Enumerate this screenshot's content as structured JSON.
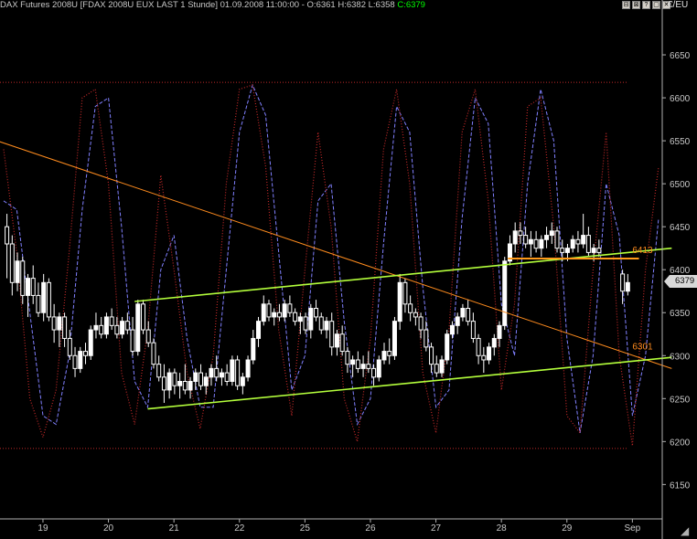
{
  "header": {
    "title": "DAX Futures 2008U [FDAX 2008U EUX LAST 1 Stunde]",
    "datetime": "01.09.2008 11:00:00",
    "ohlc": "- O:6361 H:6382 L:6358",
    "close": "C:6379",
    "currency": "€/EU",
    "window_buttons": [
      "⊟",
      "⊠",
      "?",
      "▢",
      "✕"
    ]
  },
  "last_price_label": "6379",
  "colors": {
    "background": "#000000",
    "candle": "#ffffff",
    "stoch_k": "#c02828",
    "stoch_d": "#8080ff",
    "channel_lines": "#b4ff3c",
    "downtrend_line": "#ff8c1e",
    "horizontal_resistance": "#ff9a1a",
    "labels_orange": "#ff8c1e",
    "grid_text": "#c8c8c8",
    "close_value": "#00ff00"
  },
  "chart_data": {
    "type": "candlestick",
    "title": "DAX Futures 2008U [FDAX 2008U EUX LAST 1 Stunde]",
    "ylabel": "€/EU",
    "ylim": [
      6110,
      6700
    ],
    "yticks": [
      6150,
      6200,
      6250,
      6300,
      6350,
      6400,
      6450,
      6500,
      6550,
      6600,
      6650
    ],
    "xticks": [
      "19",
      "20",
      "21",
      "22",
      "25",
      "26",
      "27",
      "28",
      "29",
      "Sep"
    ],
    "x_index_range": [
      0,
      100
    ],
    "xtick_index": [
      6,
      16,
      26,
      36,
      46,
      56,
      66,
      76,
      86,
      96
    ],
    "candles": [
      [
        0.5,
        6450,
        6465,
        6390,
        6430
      ],
      [
        1.3,
        6430,
        6440,
        6370,
        6385
      ],
      [
        2.1,
        6385,
        6420,
        6375,
        6410
      ],
      [
        2.9,
        6410,
        6415,
        6360,
        6370
      ],
      [
        3.7,
        6370,
        6395,
        6345,
        6390
      ],
      [
        4.5,
        6390,
        6405,
        6360,
        6370
      ],
      [
        5.3,
        6370,
        6385,
        6345,
        6350
      ],
      [
        6.1,
        6350,
        6395,
        6340,
        6385
      ],
      [
        6.9,
        6385,
        6390,
        6340,
        6345
      ],
      [
        7.7,
        6345,
        6360,
        6315,
        6330
      ],
      [
        8.5,
        6330,
        6350,
        6310,
        6345
      ],
      [
        9.3,
        6345,
        6350,
        6310,
        6320
      ],
      [
        10.1,
        6320,
        6330,
        6295,
        6300
      ],
      [
        10.9,
        6300,
        6310,
        6275,
        6285
      ],
      [
        11.7,
        6285,
        6310,
        6280,
        6305
      ],
      [
        12.5,
        6305,
        6315,
        6290,
        6300
      ],
      [
        13.3,
        6300,
        6335,
        6295,
        6330
      ],
      [
        14.1,
        6330,
        6350,
        6320,
        6335
      ],
      [
        14.9,
        6335,
        6345,
        6320,
        6325
      ],
      [
        15.7,
        6325,
        6350,
        6320,
        6345
      ],
      [
        16.5,
        6345,
        6355,
        6330,
        6335
      ],
      [
        17.3,
        6335,
        6345,
        6320,
        6325
      ],
      [
        18.1,
        6325,
        6345,
        6320,
        6340
      ],
      [
        18.9,
        6340,
        6350,
        6325,
        6330
      ],
      [
        19.7,
        6330,
        6345,
        6300,
        6305
      ],
      [
        20.5,
        6305,
        6365,
        6300,
        6360
      ],
      [
        21.3,
        6360,
        6365,
        6325,
        6330
      ],
      [
        22.1,
        6330,
        6340,
        6310,
        6315
      ],
      [
        22.9,
        6315,
        6320,
        6285,
        6290
      ],
      [
        23.7,
        6290,
        6300,
        6270,
        6275
      ],
      [
        24.5,
        6275,
        6290,
        6245,
        6260
      ],
      [
        25.3,
        6260,
        6285,
        6250,
        6280
      ],
      [
        26.1,
        6280,
        6285,
        6255,
        6265
      ],
      [
        26.9,
        6265,
        6280,
        6250,
        6270
      ],
      [
        27.7,
        6270,
        6290,
        6255,
        6260
      ],
      [
        28.5,
        6260,
        6275,
        6250,
        6270
      ],
      [
        29.3,
        6270,
        6285,
        6260,
        6280
      ],
      [
        30.1,
        6280,
        6290,
        6260,
        6265
      ],
      [
        30.9,
        6265,
        6280,
        6255,
        6275
      ],
      [
        31.7,
        6275,
        6290,
        6265,
        6285
      ],
      [
        32.5,
        6285,
        6300,
        6270,
        6275
      ],
      [
        33.3,
        6275,
        6285,
        6265,
        6280
      ],
      [
        34.1,
        6280,
        6290,
        6265,
        6270
      ],
      [
        34.9,
        6270,
        6300,
        6265,
        6295
      ],
      [
        35.7,
        6295,
        6300,
        6260,
        6265
      ],
      [
        36.5,
        6265,
        6280,
        6255,
        6275
      ],
      [
        37.3,
        6275,
        6300,
        6270,
        6295
      ],
      [
        38.1,
        6295,
        6330,
        6290,
        6320
      ],
      [
        38.9,
        6320,
        6345,
        6310,
        6340
      ],
      [
        39.7,
        6340,
        6370,
        6335,
        6360
      ],
      [
        40.5,
        6360,
        6365,
        6340,
        6345
      ],
      [
        41.3,
        6345,
        6355,
        6335,
        6350
      ],
      [
        42.1,
        6350,
        6360,
        6340,
        6345
      ],
      [
        42.9,
        6345,
        6365,
        6340,
        6360
      ],
      [
        43.7,
        6360,
        6370,
        6345,
        6350
      ],
      [
        44.5,
        6350,
        6355,
        6335,
        6340
      ],
      [
        45.3,
        6340,
        6350,
        6325,
        6345
      ],
      [
        46.1,
        6345,
        6350,
        6325,
        6330
      ],
      [
        46.9,
        6330,
        6360,
        6320,
        6355
      ],
      [
        47.7,
        6355,
        6365,
        6340,
        6345
      ],
      [
        48.5,
        6345,
        6350,
        6325,
        6330
      ],
      [
        49.3,
        6330,
        6345,
        6320,
        6340
      ],
      [
        50.1,
        6340,
        6350,
        6300,
        6310
      ],
      [
        50.9,
        6310,
        6330,
        6300,
        6325
      ],
      [
        51.7,
        6325,
        6335,
        6300,
        6305
      ],
      [
        52.5,
        6305,
        6310,
        6280,
        6290
      ],
      [
        53.3,
        6290,
        6300,
        6275,
        6295
      ],
      [
        54.1,
        6295,
        6305,
        6280,
        6285
      ],
      [
        54.9,
        6285,
        6300,
        6275,
        6290
      ],
      [
        55.7,
        6290,
        6305,
        6280,
        6285
      ],
      [
        56.5,
        6285,
        6290,
        6265,
        6275
      ],
      [
        57.3,
        6275,
        6300,
        6270,
        6295
      ],
      [
        58.1,
        6295,
        6315,
        6290,
        6305
      ],
      [
        58.9,
        6305,
        6320,
        6290,
        6300
      ],
      [
        59.7,
        6300,
        6345,
        6295,
        6340
      ],
      [
        60.5,
        6340,
        6395,
        6330,
        6385
      ],
      [
        61.3,
        6385,
        6390,
        6350,
        6360
      ],
      [
        62.1,
        6360,
        6370,
        6340,
        6350
      ],
      [
        62.9,
        6350,
        6355,
        6335,
        6345
      ],
      [
        63.7,
        6345,
        6350,
        6320,
        6330
      ],
      [
        64.5,
        6330,
        6340,
        6305,
        6310
      ],
      [
        65.3,
        6310,
        6315,
        6280,
        6290
      ],
      [
        66.1,
        6290,
        6300,
        6275,
        6280
      ],
      [
        66.9,
        6280,
        6300,
        6275,
        6295
      ],
      [
        67.7,
        6295,
        6330,
        6290,
        6325
      ],
      [
        68.5,
        6325,
        6340,
        6320,
        6335
      ],
      [
        69.3,
        6335,
        6350,
        6325,
        6345
      ],
      [
        70.1,
        6345,
        6360,
        6340,
        6355
      ],
      [
        70.9,
        6355,
        6365,
        6335,
        6340
      ],
      [
        71.7,
        6340,
        6350,
        6315,
        6320
      ],
      [
        72.5,
        6320,
        6325,
        6290,
        6300
      ],
      [
        73.3,
        6300,
        6310,
        6280,
        6295
      ],
      [
        74.1,
        6295,
        6315,
        6290,
        6310
      ],
      [
        74.9,
        6310,
        6325,
        6300,
        6320
      ],
      [
        75.7,
        6320,
        6340,
        6310,
        6335
      ],
      [
        76.5,
        6335,
        6415,
        6330,
        6410
      ],
      [
        77.3,
        6410,
        6440,
        6405,
        6430
      ],
      [
        78.1,
        6430,
        6455,
        6420,
        6445
      ],
      [
        78.9,
        6445,
        6455,
        6430,
        6440
      ],
      [
        79.7,
        6440,
        6450,
        6425,
        6430
      ]
    ],
    "candles_extra": [
      [
        80.5,
        6430,
        6445,
        6415,
        6435
      ],
      [
        81.3,
        6435,
        6445,
        6420,
        6425
      ],
      [
        82.1,
        6425,
        6440,
        6415,
        6435
      ],
      [
        82.9,
        6435,
        6450,
        6425,
        6440
      ],
      [
        83.7,
        6440,
        6455,
        6430,
        6445
      ],
      [
        84.5,
        6445,
        6450,
        6420,
        6425
      ],
      [
        85.3,
        6425,
        6435,
        6410,
        6420
      ],
      [
        86.1,
        6420,
        6430,
        6410,
        6425
      ],
      [
        86.9,
        6425,
        6440,
        6420,
        6435
      ],
      [
        87.7,
        6435,
        6445,
        6420,
        6430
      ],
      [
        88.5,
        6430,
        6465,
        6425,
        6440
      ],
      [
        89.3,
        6440,
        6450,
        6415,
        6420
      ],
      [
        90.1,
        6420,
        6430,
        6410,
        6425
      ],
      [
        90.9,
        6425,
        6435,
        6415,
        6420
      ],
      [
        94.5,
        6395,
        6400,
        6360,
        6375
      ],
      [
        95.3,
        6375,
        6395,
        6370,
        6385
      ]
    ],
    "stoch_k": [
      [
        0,
        6540
      ],
      [
        2,
        6420
      ],
      [
        4,
        6250
      ],
      [
        6,
        6205
      ],
      [
        8,
        6260
      ],
      [
        10,
        6420
      ],
      [
        12,
        6600
      ],
      [
        14,
        6610
      ],
      [
        16,
        6500
      ],
      [
        18,
        6280
      ],
      [
        20,
        6220
      ],
      [
        22,
        6330
      ],
      [
        24,
        6510
      ],
      [
        26,
        6400
      ],
      [
        28,
        6280
      ],
      [
        30,
        6215
      ],
      [
        32,
        6300
      ],
      [
        34,
        6500
      ],
      [
        36,
        6610
      ],
      [
        38,
        6615
      ],
      [
        40,
        6520
      ],
      [
        42,
        6330
      ],
      [
        44,
        6230
      ],
      [
        46,
        6400
      ],
      [
        48,
        6560
      ],
      [
        50,
        6450
      ],
      [
        52,
        6250
      ],
      [
        54,
        6200
      ],
      [
        56,
        6320
      ],
      [
        58,
        6540
      ],
      [
        60,
        6610
      ],
      [
        62,
        6500
      ],
      [
        64,
        6280
      ],
      [
        66,
        6210
      ],
      [
        68,
        6330
      ],
      [
        70,
        6560
      ],
      [
        72,
        6610
      ],
      [
        74,
        6480
      ],
      [
        76,
        6260
      ],
      [
        78,
        6360
      ],
      [
        80,
        6590
      ],
      [
        82,
        6600
      ],
      [
        84,
        6450
      ],
      [
        86,
        6230
      ],
      [
        88,
        6210
      ],
      [
        90,
        6400
      ],
      [
        92,
        6560
      ],
      [
        94,
        6300
      ],
      [
        96,
        6195
      ],
      [
        98,
        6400
      ],
      [
        100,
        6520
      ]
    ],
    "stoch_d": [
      [
        0,
        6480
      ],
      [
        2,
        6470
      ],
      [
        4,
        6350
      ],
      [
        6,
        6230
      ],
      [
        8,
        6220
      ],
      [
        10,
        6300
      ],
      [
        12,
        6470
      ],
      [
        14,
        6590
      ],
      [
        16,
        6600
      ],
      [
        18,
        6450
      ],
      [
        20,
        6270
      ],
      [
        22,
        6240
      ],
      [
        24,
        6400
      ],
      [
        26,
        6440
      ],
      [
        28,
        6320
      ],
      [
        30,
        6240
      ],
      [
        32,
        6240
      ],
      [
        34,
        6400
      ],
      [
        36,
        6560
      ],
      [
        38,
        6615
      ],
      [
        40,
        6580
      ],
      [
        42,
        6420
      ],
      [
        44,
        6260
      ],
      [
        46,
        6300
      ],
      [
        48,
        6480
      ],
      [
        50,
        6500
      ],
      [
        52,
        6340
      ],
      [
        54,
        6220
      ],
      [
        56,
        6250
      ],
      [
        58,
        6430
      ],
      [
        60,
        6590
      ],
      [
        62,
        6560
      ],
      [
        64,
        6380
      ],
      [
        66,
        6240
      ],
      [
        68,
        6260
      ],
      [
        70,
        6460
      ],
      [
        72,
        6600
      ],
      [
        74,
        6570
      ],
      [
        76,
        6360
      ],
      [
        78,
        6300
      ],
      [
        80,
        6500
      ],
      [
        82,
        6610
      ],
      [
        84,
        6550
      ],
      [
        86,
        6320
      ],
      [
        88,
        6210
      ],
      [
        90,
        6300
      ],
      [
        92,
        6500
      ],
      [
        94,
        6440
      ],
      [
        96,
        6230
      ],
      [
        98,
        6300
      ],
      [
        100,
        6460
      ]
    ],
    "annotations": [
      {
        "type": "ray",
        "name": "downtrend",
        "from": [
          -1,
          6550
        ],
        "to": [
          102,
          6285
        ]
      },
      {
        "type": "ray",
        "name": "channel-upper",
        "from": [
          20,
          6363
        ],
        "to": [
          102,
          6425
        ]
      },
      {
        "type": "ray",
        "name": "channel-lower",
        "from": [
          22,
          6238
        ],
        "to": [
          102,
          6298
        ]
      },
      {
        "type": "segment",
        "name": "horizontal-resistance",
        "from": [
          77,
          6413
        ],
        "to": [
          97,
          6413
        ]
      },
      {
        "type": "hline",
        "name": "stoch-upper-band",
        "y": 6618
      },
      {
        "type": "hline",
        "name": "stoch-lower-band",
        "y": 6192
      }
    ],
    "labels": [
      {
        "text": "6413",
        "x": 96,
        "y": 6413
      },
      {
        "text": "6301",
        "x": 96,
        "y": 6301
      }
    ]
  }
}
